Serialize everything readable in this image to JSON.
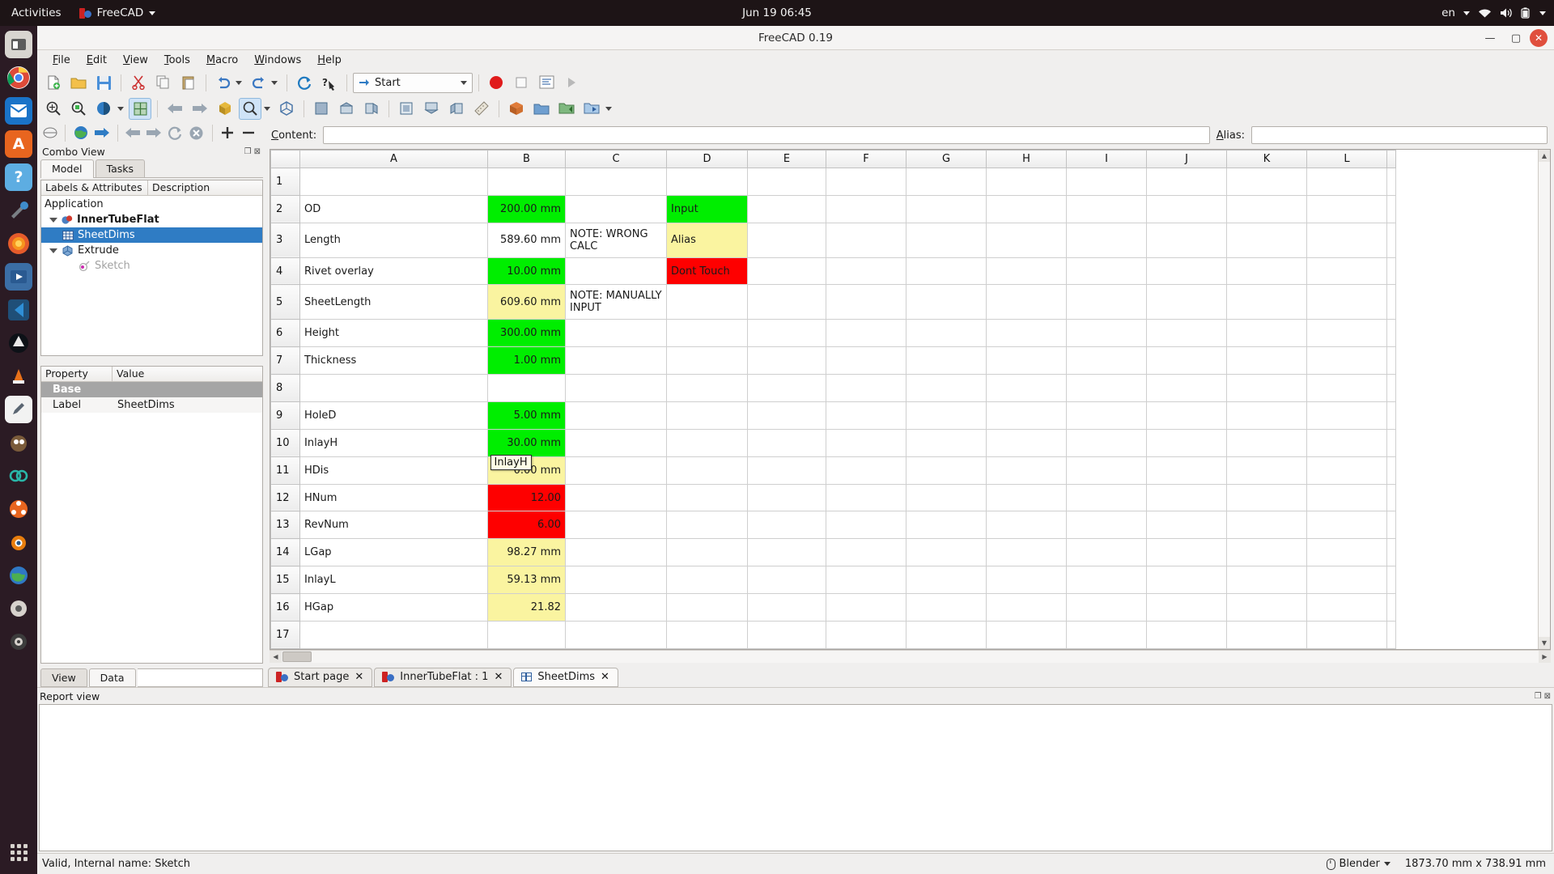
{
  "desktop": {
    "activities": "Activities",
    "app_menu": "FreeCAD",
    "clock": "Jun 19  06:45",
    "language": "en"
  },
  "window": {
    "title": "FreeCAD 0.19",
    "minimize": "—",
    "maximize": "▢",
    "close": "✕"
  },
  "menubar": [
    {
      "label": "File"
    },
    {
      "label": "Edit"
    },
    {
      "label": "View"
    },
    {
      "label": "Tools"
    },
    {
      "label": "Macro"
    },
    {
      "label": "Windows"
    },
    {
      "label": "Help"
    }
  ],
  "workbench": {
    "selected": "Start"
  },
  "combo_view": {
    "title": "Combo View",
    "tabs": [
      {
        "label": "Model",
        "selected": true
      },
      {
        "label": "Tasks",
        "selected": false
      }
    ],
    "tree_headers": [
      "Labels & Attributes",
      "Description"
    ],
    "tree": [
      {
        "label": "Application",
        "indent": 0,
        "bold": false,
        "selected": false,
        "dim": false,
        "arrow": false,
        "icon": "none"
      },
      {
        "label": "InnerTubeFlat",
        "indent": 1,
        "bold": true,
        "selected": false,
        "dim": false,
        "arrow": true,
        "icon": "document-icon"
      },
      {
        "label": "SheetDims",
        "indent": 2,
        "bold": false,
        "selected": true,
        "dim": false,
        "arrow": false,
        "icon": "spreadsheet-icon"
      },
      {
        "label": "Extrude",
        "indent": 1,
        "bold": false,
        "selected": false,
        "dim": false,
        "arrow": true,
        "icon": "extrude-icon"
      },
      {
        "label": "Sketch",
        "indent": 2,
        "bold": false,
        "selected": false,
        "dim": true,
        "arrow": false,
        "icon": "sketch-icon"
      }
    ],
    "property_headers": [
      "Property",
      "Value"
    ],
    "properties": [
      {
        "name": "Base",
        "value": "",
        "group": true
      },
      {
        "name": "Label",
        "value": "SheetDims",
        "group": false
      }
    ],
    "bottom_tabs": [
      {
        "label": "View",
        "selected": false
      },
      {
        "label": "Data",
        "selected": true
      }
    ]
  },
  "sheet_toolbar": {
    "content_label": "Content:",
    "content_value": "",
    "content_placeholder": "",
    "alias_label": "Alias:",
    "alias_value": "",
    "alias_placeholder": ""
  },
  "spreadsheet": {
    "columns": [
      "A",
      "B",
      "C",
      "D",
      "E",
      "F",
      "G",
      "H",
      "I",
      "J",
      "K",
      "L"
    ],
    "rows": [
      {
        "n": "1",
        "a": "",
        "b": "",
        "c": "",
        "d": ""
      },
      {
        "n": "2",
        "a": "OD",
        "b": "200.00 mm",
        "c": "",
        "d": "Input"
      },
      {
        "n": "3",
        "a": "Length",
        "b": "589.60 mm",
        "c": "NOTE: WRONG CALC",
        "d": "Alias"
      },
      {
        "n": "4",
        "a": "Rivet overlay",
        "b": "10.00 mm",
        "c": "",
        "d": "Dont Touch"
      },
      {
        "n": "5",
        "a": "SheetLength",
        "b": "609.60 mm",
        "c": "NOTE: MANUALLY INPUT",
        "d": ""
      },
      {
        "n": "6",
        "a": "Height",
        "b": "300.00 mm",
        "c": "",
        "d": ""
      },
      {
        "n": "7",
        "a": "Thickness",
        "b": "1.00 mm",
        "c": "",
        "d": ""
      },
      {
        "n": "8",
        "a": "",
        "b": "",
        "c": "",
        "d": ""
      },
      {
        "n": "9",
        "a": "HoleD",
        "b": "5.00 mm",
        "c": "",
        "d": ""
      },
      {
        "n": "10",
        "a": "InlayH",
        "b": "30.00 mm",
        "c": "",
        "d": ""
      },
      {
        "n": "11",
        "a": "HDis",
        "b": "0.00 mm",
        "c": "",
        "d": ""
      },
      {
        "n": "12",
        "a": "HNum",
        "b": "12.00",
        "c": "",
        "d": ""
      },
      {
        "n": "13",
        "a": "RevNum",
        "b": "6.00",
        "c": "",
        "d": ""
      },
      {
        "n": "14",
        "a": "LGap",
        "b": "98.27 mm",
        "c": "",
        "d": ""
      },
      {
        "n": "15",
        "a": "InlayL",
        "b": "59.13 mm",
        "c": "",
        "d": ""
      },
      {
        "n": "16",
        "a": "HGap",
        "b": "21.82",
        "c": "",
        "d": ""
      },
      {
        "n": "17",
        "a": "",
        "b": "",
        "c": "",
        "d": ""
      }
    ],
    "cell_fills": {
      "b": {
        "2": "green",
        "3": "none",
        "4": "green",
        "5": "yellow",
        "6": "green",
        "7": "green",
        "9": "green",
        "10": "green",
        "11": "yellow",
        "12": "red",
        "13": "red",
        "14": "yellow",
        "15": "yellow",
        "16": "yellow"
      },
      "d": {
        "2": "green",
        "3": "yellow",
        "4": "red"
      }
    },
    "tooltip": {
      "text": "InlayH",
      "over_cell": "B11"
    }
  },
  "colors": {
    "green": "#00ee00",
    "yellow": "#faf4a0",
    "red": "#fe0000",
    "selection_blue": "#2f7cc4",
    "accent_red": "#cc2222"
  },
  "document_tabs": [
    {
      "label": "Start page",
      "icon": "freecad-icon",
      "close": "✕",
      "selected": false
    },
    {
      "label": "InnerTubeFlat : 1",
      "icon": "freecad-icon",
      "close": "✕",
      "selected": false
    },
    {
      "label": "SheetDims",
      "icon": "spreadsheet-icon",
      "close": "✕",
      "selected": true
    }
  ],
  "report_view": {
    "title": "Report view",
    "content": ""
  },
  "statusbar": {
    "message": "Valid, Internal name: Sketch",
    "nav_style": "Blender",
    "dimensions": "1873.70 mm x 738.91 mm"
  }
}
